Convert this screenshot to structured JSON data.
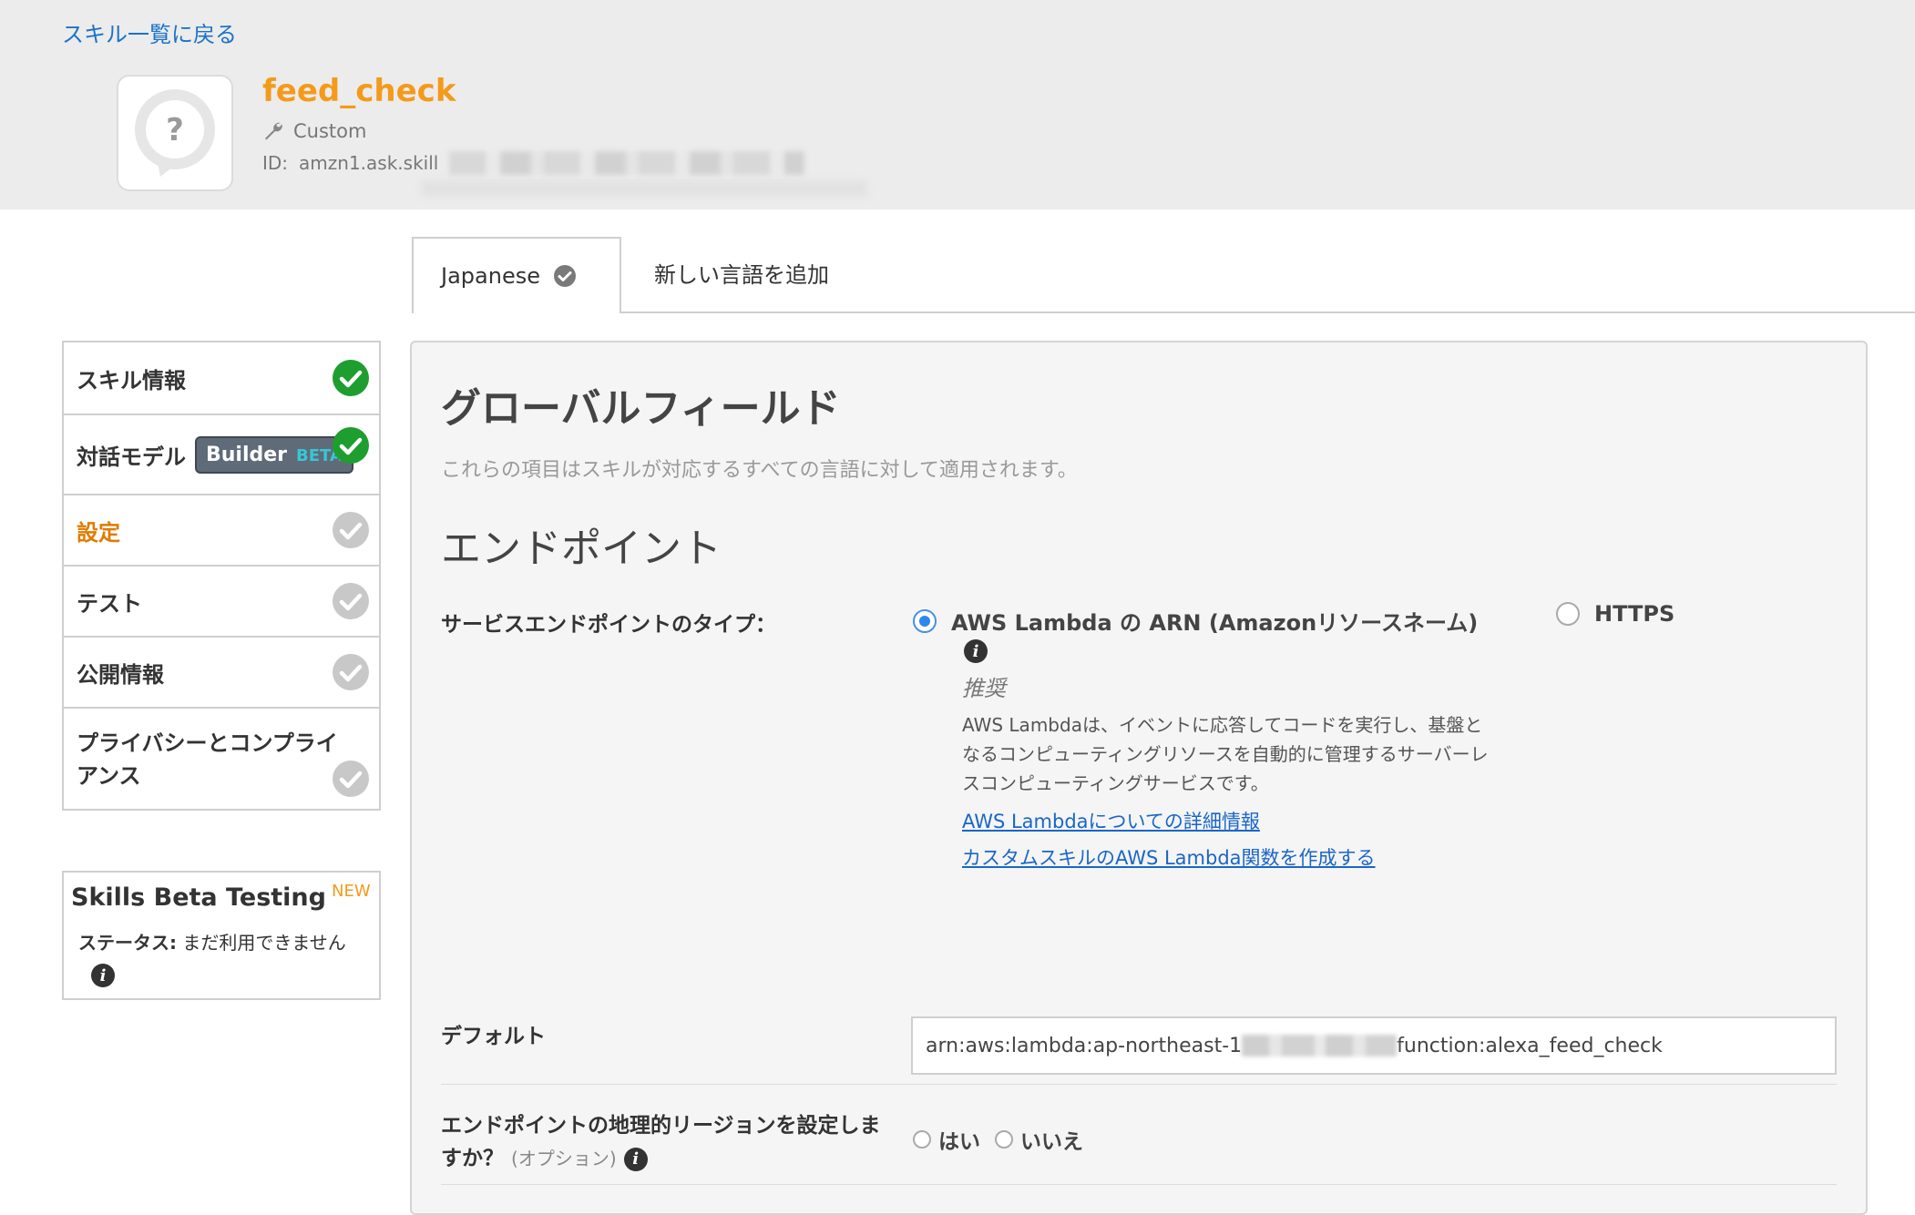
{
  "header": {
    "back_link": "スキル一覧に戻る",
    "skill_name": "feed_check",
    "skill_type": "Custom",
    "id_label": "ID:",
    "id_value": "amzn1.ask.skill"
  },
  "tabs": {
    "active": "Japanese",
    "add": "新しい言語を追加"
  },
  "sidebar": {
    "items": [
      {
        "label": "スキル情報",
        "status": "complete"
      },
      {
        "label": "対話モデル",
        "badge": "Builder",
        "badge_tag": "BETA",
        "status": "complete"
      },
      {
        "label": "設定",
        "status": "incomplete",
        "active": true
      },
      {
        "label": "テスト",
        "status": "incomplete"
      },
      {
        "label": "公開情報",
        "status": "incomplete"
      },
      {
        "label": "プライバシーとコンプライアンス",
        "status": "incomplete"
      }
    ]
  },
  "beta_testing": {
    "title": "Skills Beta Testing",
    "new_tag": "NEW",
    "status_label": "ステータス:",
    "status_value": "まだ利用できません"
  },
  "main": {
    "global_title": "グローバルフィールド",
    "global_desc": "これらの項目はスキルが対応するすべての言語に対して適用されます。",
    "endpoint_title": "エンドポイント",
    "service_type_label": "サービスエンドポイントのタイプ：",
    "option_lambda": "AWS Lambda の ARN (Amazonリソースネーム)",
    "option_https": "HTTPS",
    "selected_option": "lambda",
    "recommended": "推奨",
    "lambda_desc": "AWS Lambdaは、イベントに応答してコードを実行し、基盤となるコンピューティングリソースを自動的に管理するサーバーレスコンピューティングサービスです。",
    "link_details": "AWS Lambdaについての詳細情報",
    "link_create": "カスタムスキルのAWS Lambda関数を作成する",
    "default_label": "デフォルト",
    "default_value_prefix": "arn:aws:lambda:ap-northeast-1",
    "default_value_suffix": "function:alexa_feed_check",
    "region_label": "エンドポイントの地理的リージョンを設定しますか？",
    "region_optional": "(オプション)",
    "region_yes": "はい",
    "region_no": "いいえ"
  },
  "colors": {
    "accent_orange": "#f49a1b",
    "active_orange": "#e07b00",
    "link_blue": "#1a66c8",
    "check_green": "#1e9e2e",
    "check_grey": "#c8c8c8"
  }
}
